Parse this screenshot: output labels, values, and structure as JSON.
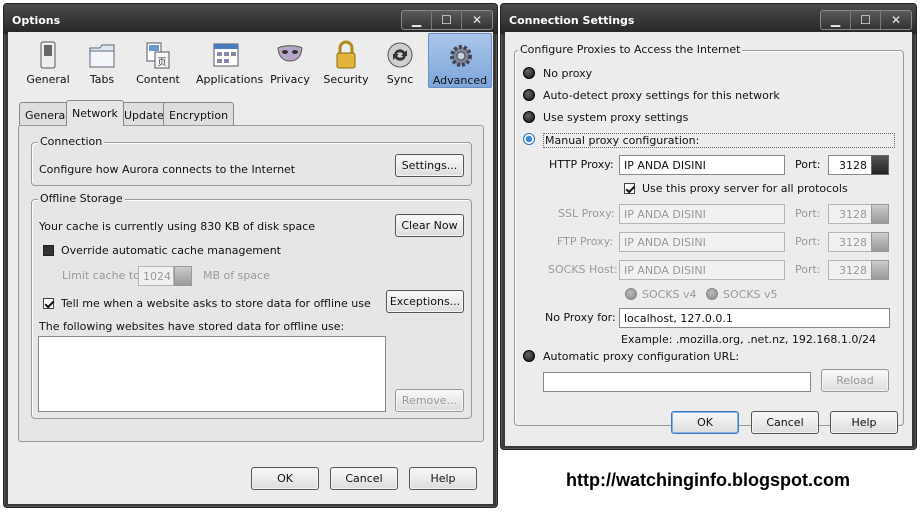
{
  "options": {
    "title": "Options",
    "categories": [
      {
        "label": "General",
        "icon": "switch-icon"
      },
      {
        "label": "Tabs",
        "icon": "folder-tabs-icon"
      },
      {
        "label": "Content",
        "icon": "content-icon"
      },
      {
        "label": "Applications",
        "icon": "applications-icon"
      },
      {
        "label": "Privacy",
        "icon": "mask-icon"
      },
      {
        "label": "Security",
        "icon": "padlock-icon"
      },
      {
        "label": "Sync",
        "icon": "sync-icon"
      },
      {
        "label": "Advanced",
        "icon": "gear-icon"
      }
    ],
    "selected_category": "Advanced",
    "subtabs": [
      "General",
      "Network",
      "Update",
      "Encryption"
    ],
    "selected_subtab": "Network",
    "connection": {
      "legend": "Connection",
      "text": "Configure how Aurora connects to the Internet",
      "settings_button": "Settings..."
    },
    "offline": {
      "legend": "Offline Storage",
      "cache_text": "Your cache is currently using 830 KB of disk space",
      "clear_button": "Clear Now",
      "override_label": "Override automatic cache management",
      "limit_label": "Limit cache to",
      "limit_value": "1024",
      "limit_unit": "MB of space",
      "tell_label": "Tell me when a website asks to store data for offline use",
      "exceptions_button": "Exceptions...",
      "websites_label": "The following websites have stored data for offline use:",
      "remove_button": "Remove..."
    },
    "ok": "OK",
    "cancel": "Cancel",
    "help": "Help"
  },
  "conn": {
    "title": "Connection Settings",
    "legend": "Configure Proxies to Access the Internet",
    "opt_no_proxy": "No proxy",
    "opt_auto_detect": "Auto-detect proxy settings for this network",
    "opt_system": "Use system proxy settings",
    "opt_manual": "Manual proxy configuration:",
    "http_label": "HTTP Proxy:",
    "http_value": "IP ANDA DISINI",
    "http_port": "3128",
    "port_label": "Port:",
    "same_proxy_label": "Use this proxy server for all protocols",
    "ssl_label": "SSL Proxy:",
    "ssl_value": "IP ANDA DISINI",
    "ssl_port": "3128",
    "ftp_label": "FTP Proxy:",
    "ftp_value": "IP ANDA DISINI",
    "ftp_port": "3128",
    "socks_label": "SOCKS Host:",
    "socks_value": "IP ANDA DISINI",
    "socks_port": "3128",
    "socks_v4": "SOCKS v4",
    "socks_v5": "SOCKS v5",
    "no_proxy_label": "No Proxy for:",
    "no_proxy_value": "localhost, 127.0.0.1",
    "example": "Example: .mozilla.org, .net.nz, 192.168.1.0/24",
    "opt_auto_url": "Automatic proxy configuration URL:",
    "auto_url_value": "",
    "reload_button": "Reload",
    "ok": "OK",
    "cancel": "Cancel",
    "help": "Help"
  },
  "watermark": "http://watchinginfo.blogspot.com"
}
